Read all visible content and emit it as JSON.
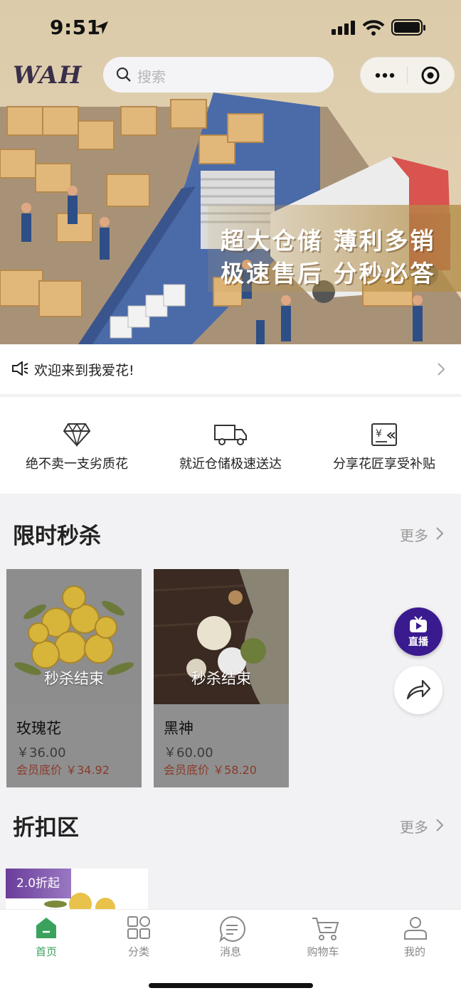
{
  "status_bar": {
    "time": "9:51"
  },
  "header": {
    "logo": "WAH",
    "search_placeholder": "搜索"
  },
  "banner": {
    "slogan_line1": "超大仓储 薄利多销",
    "slogan_line2": "极速售后 分秒必答"
  },
  "notice": {
    "text": "欢迎来到我爱花!"
  },
  "features": [
    {
      "label": "绝不卖一支劣质花",
      "icon": "diamond-icon"
    },
    {
      "label": "就近仓储极速送达",
      "icon": "truck-icon"
    },
    {
      "label": "分享花匠享受补贴",
      "icon": "subsidy-icon"
    }
  ],
  "flash_sale": {
    "title": "限时秒杀",
    "more": "更多",
    "items": [
      {
        "name": "玫瑰花",
        "status": "秒杀结束",
        "price": "￥36.00",
        "member_price": "会员底价 ￥34.92"
      },
      {
        "name": "黑神",
        "status": "秒杀结束",
        "price": "￥60.00",
        "member_price": "会员底价 ￥58.20"
      }
    ]
  },
  "floating": {
    "live_label": "直播"
  },
  "discount": {
    "title": "折扣区",
    "more": "更多",
    "badge": "2.0折起"
  },
  "tabbar": [
    {
      "label": "首页",
      "active": true
    },
    {
      "label": "分类",
      "active": false
    },
    {
      "label": "消息",
      "active": false
    },
    {
      "label": "购物车",
      "active": false
    },
    {
      "label": "我的",
      "active": false
    }
  ],
  "colors": {
    "accent": "#3aa25c",
    "live": "#3a1a8f",
    "member_price": "#8b3a2a"
  }
}
